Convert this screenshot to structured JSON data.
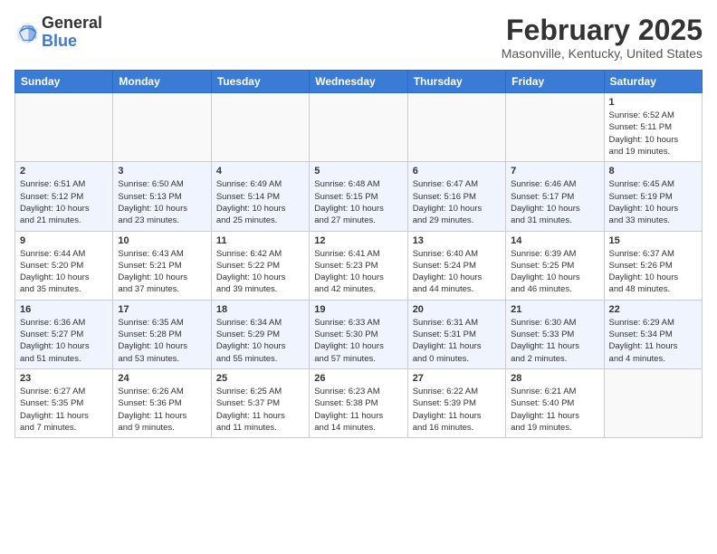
{
  "header": {
    "logo_general": "General",
    "logo_blue": "Blue",
    "month": "February 2025",
    "location": "Masonville, Kentucky, United States"
  },
  "weekdays": [
    "Sunday",
    "Monday",
    "Tuesday",
    "Wednesday",
    "Thursday",
    "Friday",
    "Saturday"
  ],
  "weeks": [
    [
      {
        "day": "",
        "info": ""
      },
      {
        "day": "",
        "info": ""
      },
      {
        "day": "",
        "info": ""
      },
      {
        "day": "",
        "info": ""
      },
      {
        "day": "",
        "info": ""
      },
      {
        "day": "",
        "info": ""
      },
      {
        "day": "1",
        "info": "Sunrise: 6:52 AM\nSunset: 5:11 PM\nDaylight: 10 hours\nand 19 minutes."
      }
    ],
    [
      {
        "day": "2",
        "info": "Sunrise: 6:51 AM\nSunset: 5:12 PM\nDaylight: 10 hours\nand 21 minutes."
      },
      {
        "day": "3",
        "info": "Sunrise: 6:50 AM\nSunset: 5:13 PM\nDaylight: 10 hours\nand 23 minutes."
      },
      {
        "day": "4",
        "info": "Sunrise: 6:49 AM\nSunset: 5:14 PM\nDaylight: 10 hours\nand 25 minutes."
      },
      {
        "day": "5",
        "info": "Sunrise: 6:48 AM\nSunset: 5:15 PM\nDaylight: 10 hours\nand 27 minutes."
      },
      {
        "day": "6",
        "info": "Sunrise: 6:47 AM\nSunset: 5:16 PM\nDaylight: 10 hours\nand 29 minutes."
      },
      {
        "day": "7",
        "info": "Sunrise: 6:46 AM\nSunset: 5:17 PM\nDaylight: 10 hours\nand 31 minutes."
      },
      {
        "day": "8",
        "info": "Sunrise: 6:45 AM\nSunset: 5:19 PM\nDaylight: 10 hours\nand 33 minutes."
      }
    ],
    [
      {
        "day": "9",
        "info": "Sunrise: 6:44 AM\nSunset: 5:20 PM\nDaylight: 10 hours\nand 35 minutes."
      },
      {
        "day": "10",
        "info": "Sunrise: 6:43 AM\nSunset: 5:21 PM\nDaylight: 10 hours\nand 37 minutes."
      },
      {
        "day": "11",
        "info": "Sunrise: 6:42 AM\nSunset: 5:22 PM\nDaylight: 10 hours\nand 39 minutes."
      },
      {
        "day": "12",
        "info": "Sunrise: 6:41 AM\nSunset: 5:23 PM\nDaylight: 10 hours\nand 42 minutes."
      },
      {
        "day": "13",
        "info": "Sunrise: 6:40 AM\nSunset: 5:24 PM\nDaylight: 10 hours\nand 44 minutes."
      },
      {
        "day": "14",
        "info": "Sunrise: 6:39 AM\nSunset: 5:25 PM\nDaylight: 10 hours\nand 46 minutes."
      },
      {
        "day": "15",
        "info": "Sunrise: 6:37 AM\nSunset: 5:26 PM\nDaylight: 10 hours\nand 48 minutes."
      }
    ],
    [
      {
        "day": "16",
        "info": "Sunrise: 6:36 AM\nSunset: 5:27 PM\nDaylight: 10 hours\nand 51 minutes."
      },
      {
        "day": "17",
        "info": "Sunrise: 6:35 AM\nSunset: 5:28 PM\nDaylight: 10 hours\nand 53 minutes."
      },
      {
        "day": "18",
        "info": "Sunrise: 6:34 AM\nSunset: 5:29 PM\nDaylight: 10 hours\nand 55 minutes."
      },
      {
        "day": "19",
        "info": "Sunrise: 6:33 AM\nSunset: 5:30 PM\nDaylight: 10 hours\nand 57 minutes."
      },
      {
        "day": "20",
        "info": "Sunrise: 6:31 AM\nSunset: 5:31 PM\nDaylight: 11 hours\nand 0 minutes."
      },
      {
        "day": "21",
        "info": "Sunrise: 6:30 AM\nSunset: 5:33 PM\nDaylight: 11 hours\nand 2 minutes."
      },
      {
        "day": "22",
        "info": "Sunrise: 6:29 AM\nSunset: 5:34 PM\nDaylight: 11 hours\nand 4 minutes."
      }
    ],
    [
      {
        "day": "23",
        "info": "Sunrise: 6:27 AM\nSunset: 5:35 PM\nDaylight: 11 hours\nand 7 minutes."
      },
      {
        "day": "24",
        "info": "Sunrise: 6:26 AM\nSunset: 5:36 PM\nDaylight: 11 hours\nand 9 minutes."
      },
      {
        "day": "25",
        "info": "Sunrise: 6:25 AM\nSunset: 5:37 PM\nDaylight: 11 hours\nand 11 minutes."
      },
      {
        "day": "26",
        "info": "Sunrise: 6:23 AM\nSunset: 5:38 PM\nDaylight: 11 hours\nand 14 minutes."
      },
      {
        "day": "27",
        "info": "Sunrise: 6:22 AM\nSunset: 5:39 PM\nDaylight: 11 hours\nand 16 minutes."
      },
      {
        "day": "28",
        "info": "Sunrise: 6:21 AM\nSunset: 5:40 PM\nDaylight: 11 hours\nand 19 minutes."
      },
      {
        "day": "",
        "info": ""
      }
    ]
  ]
}
